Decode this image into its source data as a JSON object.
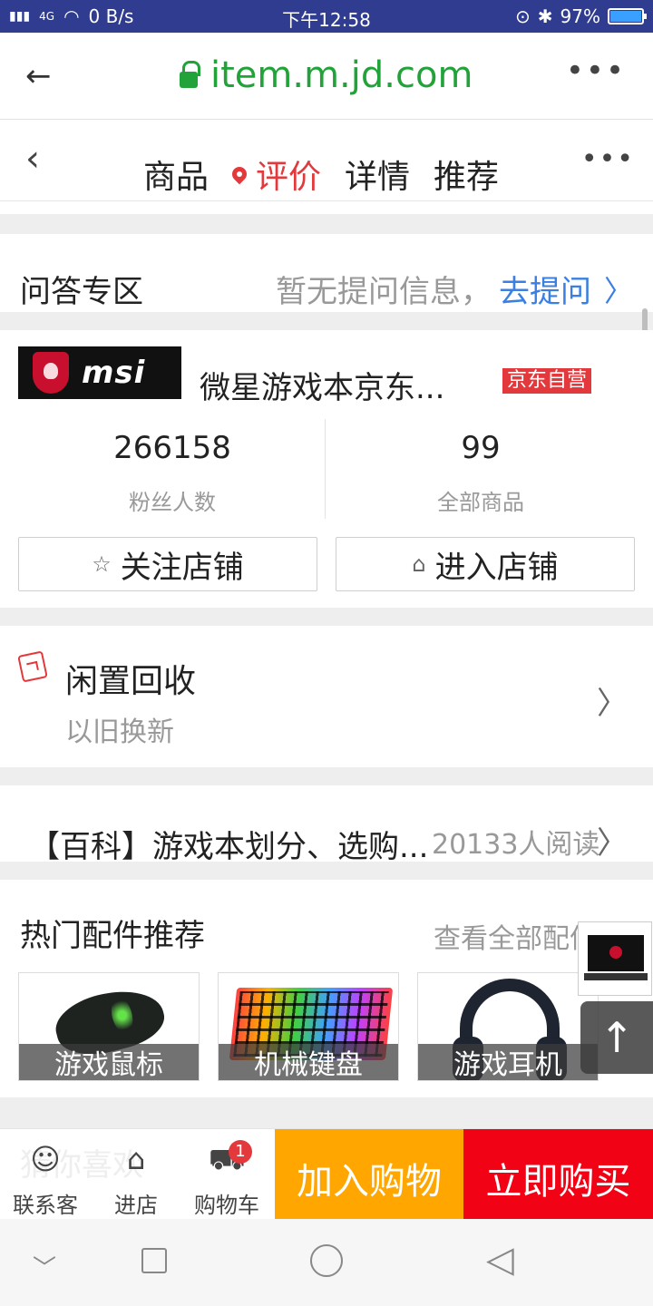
{
  "status_bar": {
    "network": "4G",
    "speed": "0 B/s",
    "time": "下午12:58",
    "battery": "97%",
    "battery_level": 0.97
  },
  "browser": {
    "url": "item.m.jd.com"
  },
  "nav": {
    "tabs": [
      "商品",
      "评价",
      "详情",
      "推荐"
    ],
    "active_tab": "评价"
  },
  "qa": {
    "title": "问答专区",
    "hint": "暂无提问信息，",
    "ask": "去提问"
  },
  "store": {
    "logo_text": "msi",
    "name": "微星游戏本京东...",
    "badge": "京东自营",
    "fans_count": "266158",
    "fans_label": "粉丝人数",
    "goods_count": "99",
    "goods_label": "全部商品",
    "follow_label": "关注店铺",
    "enter_label": "进入店铺"
  },
  "recycle": {
    "title": "闲置回收",
    "subtitle": "以旧换新"
  },
  "baike": {
    "title": "【百科】游戏本划分、选购...",
    "reads": "20133人阅读"
  },
  "accessories": {
    "title": "热门配件推荐",
    "view_all": "查看全部配件",
    "items": [
      {
        "label": "游戏鼠标"
      },
      {
        "label": "机械键盘"
      },
      {
        "label": "游戏耳机"
      }
    ]
  },
  "bottom_bar": {
    "ghost_text": "猜你喜欢",
    "contact": "联系客",
    "store": "进店",
    "cart": "购物车",
    "cart_count": "1",
    "add_cart": "加入购物",
    "buy_now": "立即购买"
  },
  "colors": {
    "accent_red": "#e4393c",
    "url_green": "#22a33a",
    "link_blue": "#3b7fe2",
    "add_cart_orange": "#ffa600",
    "buy_red": "#f10215"
  }
}
